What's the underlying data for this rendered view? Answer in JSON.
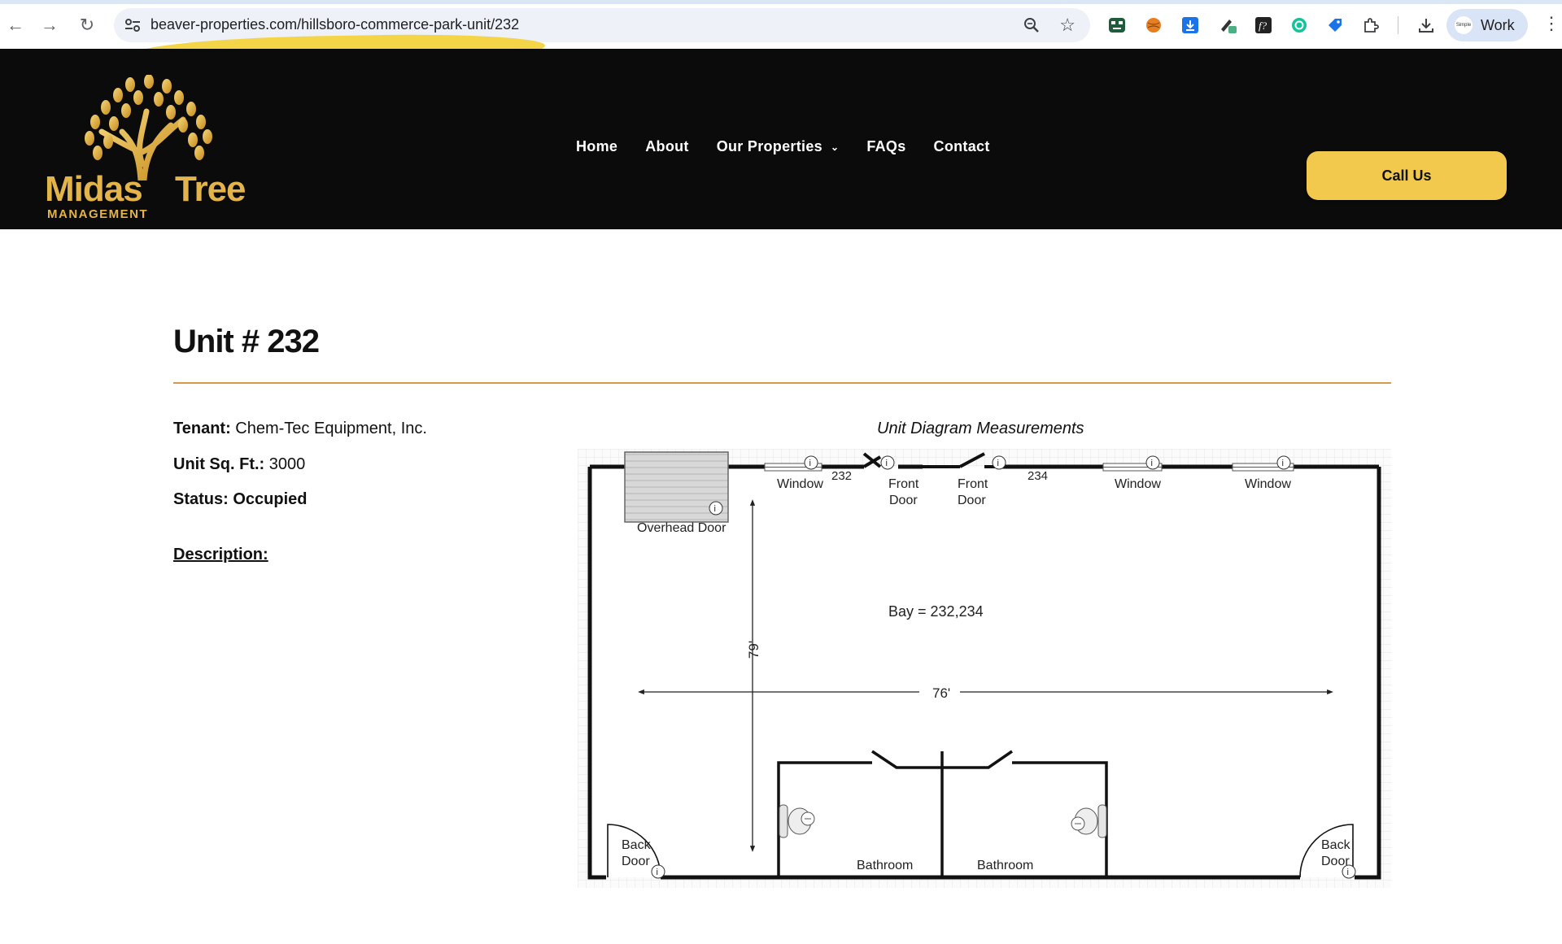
{
  "browser": {
    "url": "beaver-properties.com/hillsboro-commerce-park-unit/232",
    "profile_label": "Work",
    "profile_pic_text": "Simple"
  },
  "site": {
    "logo": {
      "word1": "Midas",
      "word2": "Tree",
      "word3": "MANAGEMENT"
    },
    "nav": [
      "Home",
      "About",
      "Our Properties",
      "FAQs",
      "Contact"
    ],
    "cta_label": "Call Us"
  },
  "unit": {
    "title": "Unit #  232",
    "tenant_label": "Tenant:",
    "tenant_value": "Chem-Tec Equipment, Inc.",
    "sqft_label": "Unit Sq. Ft.:",
    "sqft_value": "3000",
    "status_text": "Status: Occupied",
    "description_label": "Description:"
  },
  "diagram": {
    "caption": "Unit Diagram Measurements",
    "labels": {
      "overhead_door": "Overhead Door",
      "window": "Window",
      "unit_a": "232",
      "unit_b": "234",
      "front": "Front",
      "door": "Door",
      "back": "Back",
      "bay": "Bay = 232,234",
      "depth": "79'",
      "width": "76'",
      "bathroom": "Bathroom"
    }
  },
  "colors": {
    "header_bg": "#0b0b0b",
    "accent_gold": "#f2c94c",
    "divider": "#d49a4a",
    "url_highlight": "#f3d33d"
  }
}
